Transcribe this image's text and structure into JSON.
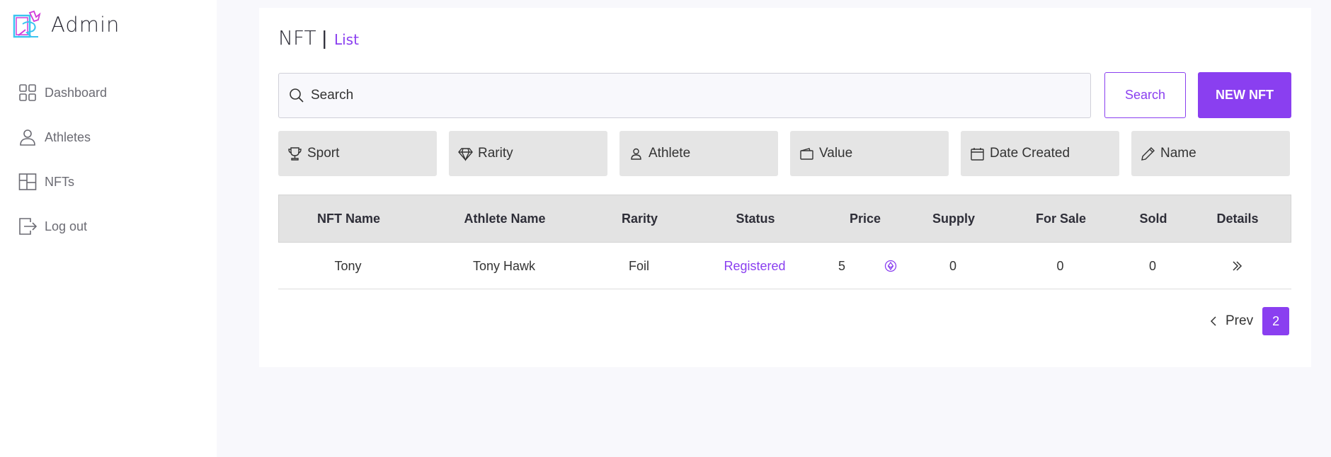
{
  "app": {
    "name": "Admin",
    "accent": "#8a3ff0"
  },
  "sidebar": {
    "items": [
      {
        "label": "Dashboard",
        "icon": "grid-icon"
      },
      {
        "label": "Athletes",
        "icon": "user-icon"
      },
      {
        "label": "NFTs",
        "icon": "layout-icon"
      },
      {
        "label": "Log out",
        "icon": "logout-icon"
      }
    ]
  },
  "header": {
    "title": "NFT",
    "separator": "|",
    "subtitle": "List"
  },
  "search": {
    "placeholder": "Search",
    "button_label": "Search",
    "new_label": "NEW NFT"
  },
  "filters": [
    {
      "label": "Sport",
      "icon": "trophy-icon"
    },
    {
      "label": "Rarity",
      "icon": "diamond-icon"
    },
    {
      "label": "Athlete",
      "icon": "person-icon"
    },
    {
      "label": "Value",
      "icon": "wallet-icon"
    },
    {
      "label": "Date Created",
      "icon": "calendar-icon"
    },
    {
      "label": "Name",
      "icon": "pencil-icon"
    }
  ],
  "table": {
    "columns": [
      "NFT Name",
      "Athlete Name",
      "Rarity",
      "Status",
      "Price",
      "Supply",
      "For Sale",
      "Sold",
      "Details"
    ],
    "rows": [
      {
        "nft_name": "Tony",
        "athlete_name": "Tony Hawk",
        "rarity": "Foil",
        "status": "Registered",
        "price": "5",
        "price_icon": "coin-icon",
        "supply": "0",
        "for_sale": "0",
        "sold": "0",
        "details_icon": "double-chevron-right-icon"
      }
    ]
  },
  "pagination": {
    "prev_label": "Prev",
    "current_page": "2"
  }
}
